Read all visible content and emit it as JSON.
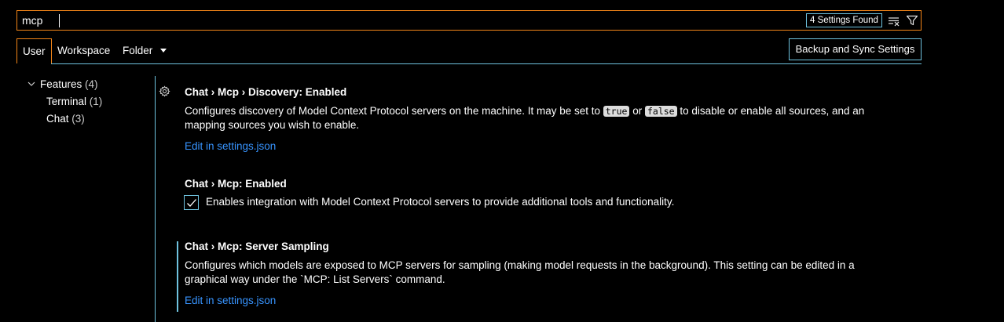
{
  "search": {
    "value": "mcp",
    "results_badge": "4 Settings Found"
  },
  "tabs": {
    "user": "User",
    "workspace": "Workspace",
    "folder": "Folder"
  },
  "sync_button": "Backup and Sync Settings",
  "toc": {
    "features": {
      "label": "Features",
      "count": "(4)"
    },
    "terminal": {
      "label": "Terminal",
      "count": "(1)"
    },
    "chat": {
      "label": "Chat",
      "count": "(3)"
    }
  },
  "settings": [
    {
      "title": "Chat › Mcp › Discovery: Enabled",
      "desc_part1": "Configures discovery of Model Context Protocol servers on the machine. It may be set to ",
      "code_true": "true",
      "desc_or": " or ",
      "code_false": "false",
      "desc_part2": " to disable or enable all sources, and an mapping sources you wish to enable.",
      "link": "Edit in settings.json"
    },
    {
      "title": "Chat › Mcp: Enabled",
      "checkbox_label": "Enables integration with Model Context Protocol servers to provide additional tools and functionality.",
      "checked": true
    },
    {
      "title": "Chat › Mcp: Server Sampling",
      "desc": "Configures which models are exposed to MCP servers for sampling (making model requests in the background). This setting can be edited in a graphical way under the `MCP: List Servers` command.",
      "link": "Edit in settings.json"
    }
  ],
  "colors": {
    "background": "#000000",
    "focus_border": "#f38518",
    "contrast_border": "#6fc3df",
    "link": "#3794ff"
  }
}
